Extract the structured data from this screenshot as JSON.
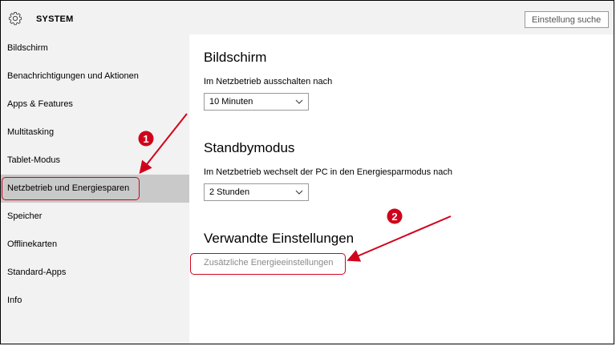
{
  "header": {
    "title": "SYSTEM",
    "search_placeholder": "Einstellung suchen"
  },
  "sidebar": {
    "items": [
      {
        "label": "Bildschirm"
      },
      {
        "label": "Benachrichtigungen und Aktionen"
      },
      {
        "label": "Apps & Features"
      },
      {
        "label": "Multitasking"
      },
      {
        "label": "Tablet-Modus"
      },
      {
        "label": "Netzbetrieb und Energiesparen",
        "selected": true
      },
      {
        "label": "Speicher"
      },
      {
        "label": "Offlinekarten"
      },
      {
        "label": "Standard-Apps"
      },
      {
        "label": "Info"
      }
    ]
  },
  "main": {
    "screen": {
      "title": "Bildschirm",
      "label": "Im Netzbetrieb ausschalten nach",
      "value": "10 Minuten"
    },
    "standby": {
      "title": "Standbymodus",
      "label": "Im Netzbetrieb wechselt der PC in den Energiesparmodus nach",
      "value": "2 Stunden"
    },
    "related": {
      "title": "Verwandte Einstellungen",
      "link": "Zusätzliche Energieeinstellungen"
    }
  },
  "annotations": {
    "badge1": "1",
    "badge2": "2",
    "color": "#d0021b"
  },
  "colors": {
    "sidebar_bg": "#f2f2f2",
    "selected_bg": "#c9c9c9",
    "link": "#8a8a8a"
  }
}
